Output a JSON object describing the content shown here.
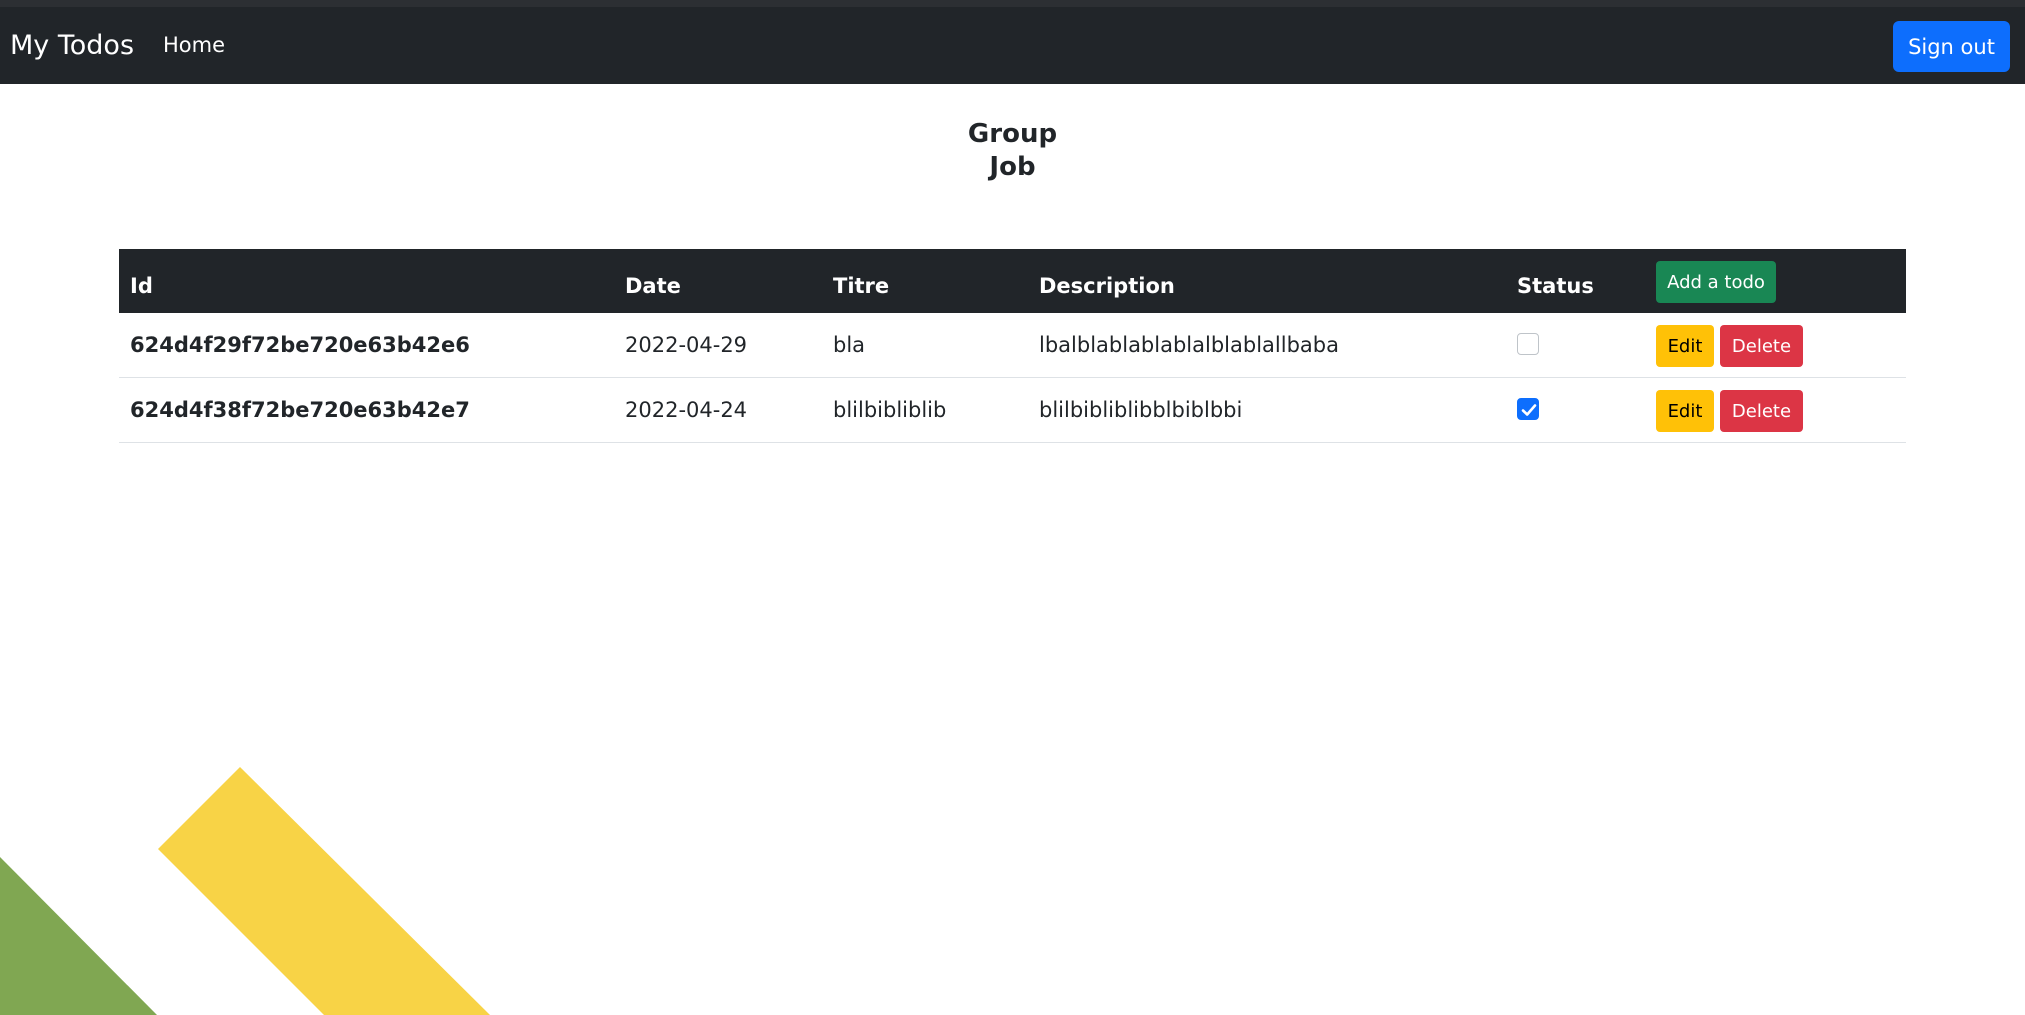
{
  "navbar": {
    "brand": "My Todos",
    "home_link": "Home",
    "signout_label": "Sign out"
  },
  "heading": {
    "line1": "Group",
    "line2": "Job"
  },
  "table": {
    "headers": {
      "id": "Id",
      "date": "Date",
      "titre": "Titre",
      "description": "Description",
      "status": "Status"
    },
    "add_button_label": "Add a todo",
    "edit_label": "Edit",
    "delete_label": "Delete",
    "rows": [
      {
        "id": "624d4f29f72be720e63b42e6",
        "date": "2022-04-29",
        "titre": "bla",
        "description": "lbalblablablablalblablallbaba",
        "status_checked": false
      },
      {
        "id": "624d4f38f72be720e63b42e7",
        "date": "2022-04-24",
        "titre": "blilbibliblib",
        "description": "blilbibliblibblbiblbbi",
        "status_checked": true
      }
    ]
  },
  "colors": {
    "navbar_bg": "#212529",
    "primary": "#0d6efd",
    "success": "#198754",
    "warning": "#ffc107",
    "danger": "#dc3545",
    "decor_green": "#80a752",
    "decor_yellow": "#f8d346"
  }
}
